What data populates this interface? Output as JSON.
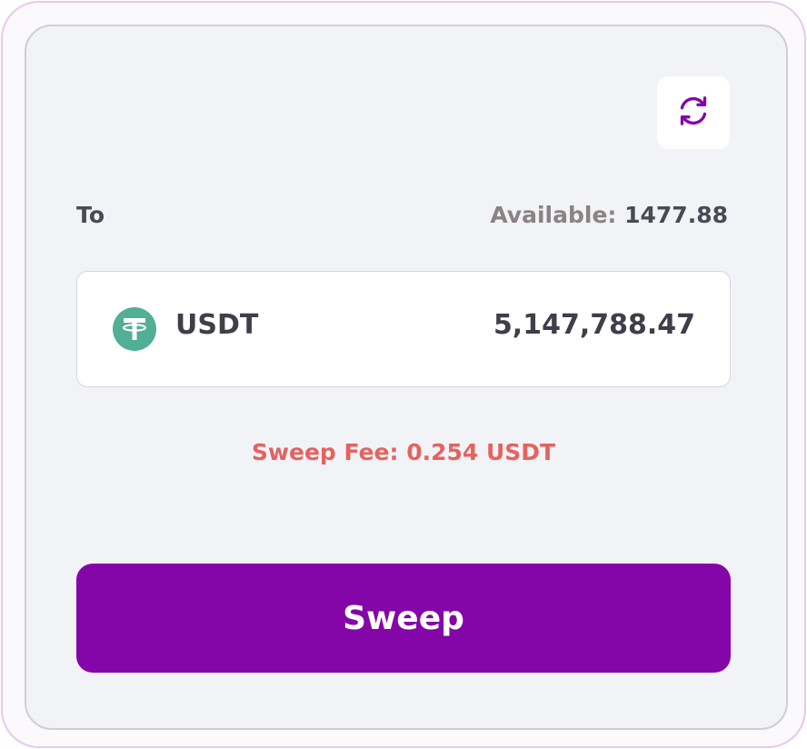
{
  "refresh": {
    "icon": "refresh-icon"
  },
  "to": {
    "label": "To"
  },
  "available": {
    "label": "Available:",
    "value": "1477.88"
  },
  "token": {
    "icon": "tether-icon",
    "symbol": "USDT",
    "amount": "5,147,788.47"
  },
  "fee": {
    "text": "Sweep Fee: 0.254 USDT"
  },
  "sweep_button": {
    "label": "Sweep"
  },
  "colors": {
    "accent": "#8506a8",
    "fee_text": "#e4635f",
    "tether_green": "#50af95"
  }
}
